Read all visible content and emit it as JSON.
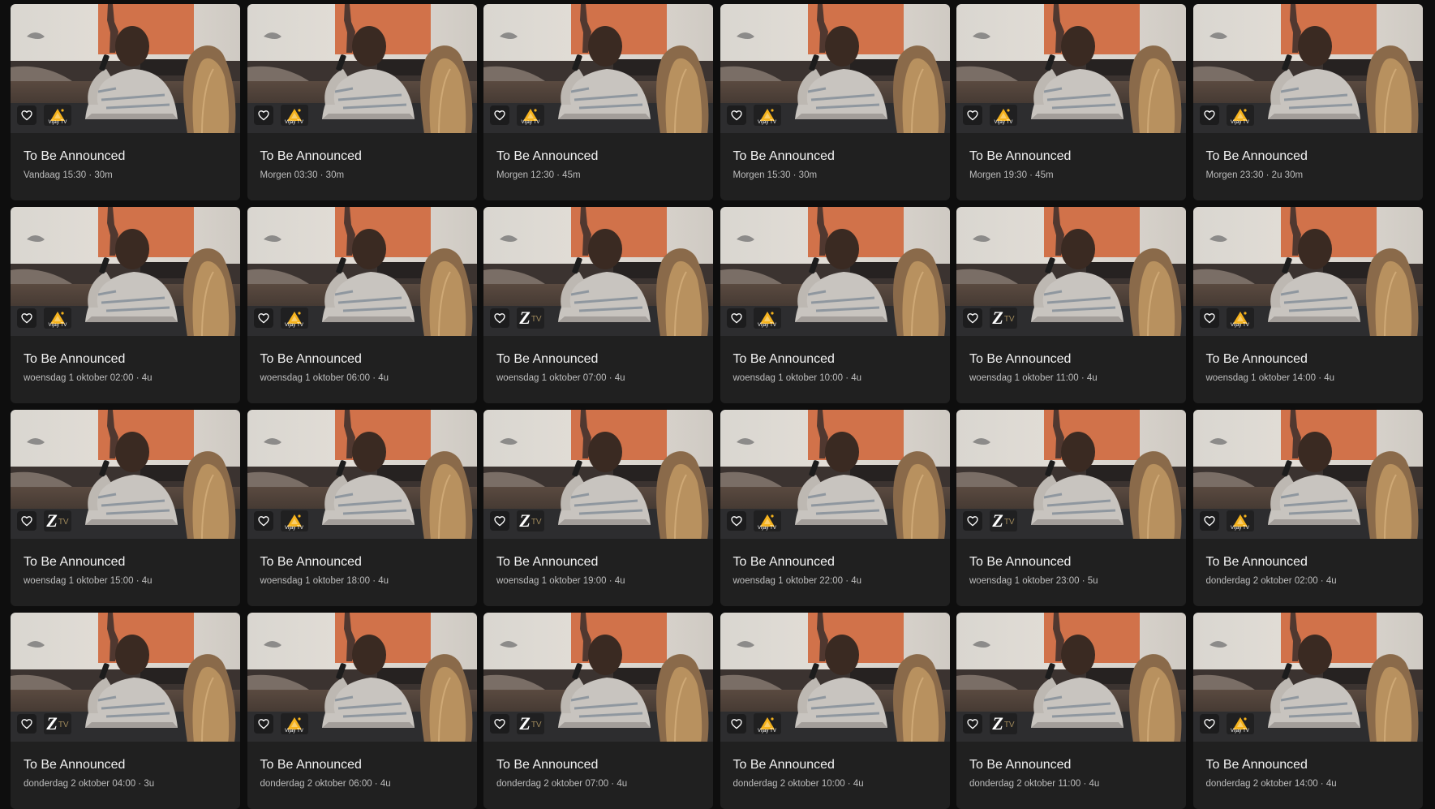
{
  "cards": [
    {
      "title": "To Be Announced",
      "meta": "Vandaag 15:30 · 30m",
      "channel": "Vijay TV"
    },
    {
      "title": "To Be Announced",
      "meta": "Morgen 03:30 · 30m",
      "channel": "Vijay TV"
    },
    {
      "title": "To Be Announced",
      "meta": "Morgen 12:30 · 45m",
      "channel": "Vijay TV"
    },
    {
      "title": "To Be Announced",
      "meta": "Morgen 15:30 · 30m",
      "channel": "Vijay TV"
    },
    {
      "title": "To Be Announced",
      "meta": "Morgen 19:30 · 45m",
      "channel": "Vijay TV"
    },
    {
      "title": "To Be Announced",
      "meta": "Morgen 23:30 · 2u 30m",
      "channel": "Vijay TV"
    },
    {
      "title": "To Be Announced",
      "meta": "woensdag 1 oktober 02:00 · 4u",
      "channel": "Vijay TV"
    },
    {
      "title": "To Be Announced",
      "meta": "woensdag 1 oktober 06:00 · 4u",
      "channel": "Vijay TV"
    },
    {
      "title": "To Be Announced",
      "meta": "woensdag 1 oktober 07:00 · 4u",
      "channel": "Z TV"
    },
    {
      "title": "To Be Announced",
      "meta": "woensdag 1 oktober 10:00 · 4u",
      "channel": "Vijay TV"
    },
    {
      "title": "To Be Announced",
      "meta": "woensdag 1 oktober 11:00 · 4u",
      "channel": "Z TV"
    },
    {
      "title": "To Be Announced",
      "meta": "woensdag 1 oktober 14:00 · 4u",
      "channel": "Vijay TV"
    },
    {
      "title": "To Be Announced",
      "meta": "woensdag 1 oktober 15:00 · 4u",
      "channel": "Z TV"
    },
    {
      "title": "To Be Announced",
      "meta": "woensdag 1 oktober 18:00 · 4u",
      "channel": "Vijay TV"
    },
    {
      "title": "To Be Announced",
      "meta": "woensdag 1 oktober 19:00 · 4u",
      "channel": "Z TV"
    },
    {
      "title": "To Be Announced",
      "meta": "woensdag 1 oktober 22:00 · 4u",
      "channel": "Vijay TV"
    },
    {
      "title": "To Be Announced",
      "meta": "woensdag 1 oktober 23:00 · 5u",
      "channel": "Z TV"
    },
    {
      "title": "To Be Announced",
      "meta": "donderdag 2 oktober 02:00 · 4u",
      "channel": "Vijay TV"
    },
    {
      "title": "To Be Announced",
      "meta": "donderdag 2 oktober 04:00 · 3u",
      "channel": "Z TV"
    },
    {
      "title": "To Be Announced",
      "meta": "donderdag 2 oktober 06:00 · 4u",
      "channel": "Vijay TV"
    },
    {
      "title": "To Be Announced",
      "meta": "donderdag 2 oktober 07:00 · 4u",
      "channel": "Z TV"
    },
    {
      "title": "To Be Announced",
      "meta": "donderdag 2 oktober 10:00 · 4u",
      "channel": "Vijay TV"
    },
    {
      "title": "To Be Announced",
      "meta": "donderdag 2 oktober 11:00 · 4u",
      "channel": "Z TV"
    },
    {
      "title": "To Be Announced",
      "meta": "donderdag 2 oktober 14:00 · 4u",
      "channel": "Vijay TV"
    }
  ],
  "logos": {
    "vijay_label": "Vijay TV",
    "z_letter": "Z",
    "z_suffix": "TV"
  },
  "icons": {
    "favorite": "heart-outline-icon"
  },
  "colors": {
    "page_bg": "#0e0e0e",
    "card_bg": "#202020",
    "title": "#f2f2f2",
    "meta": "#bdbdbd",
    "vijay_accent": "#f5b21c"
  }
}
